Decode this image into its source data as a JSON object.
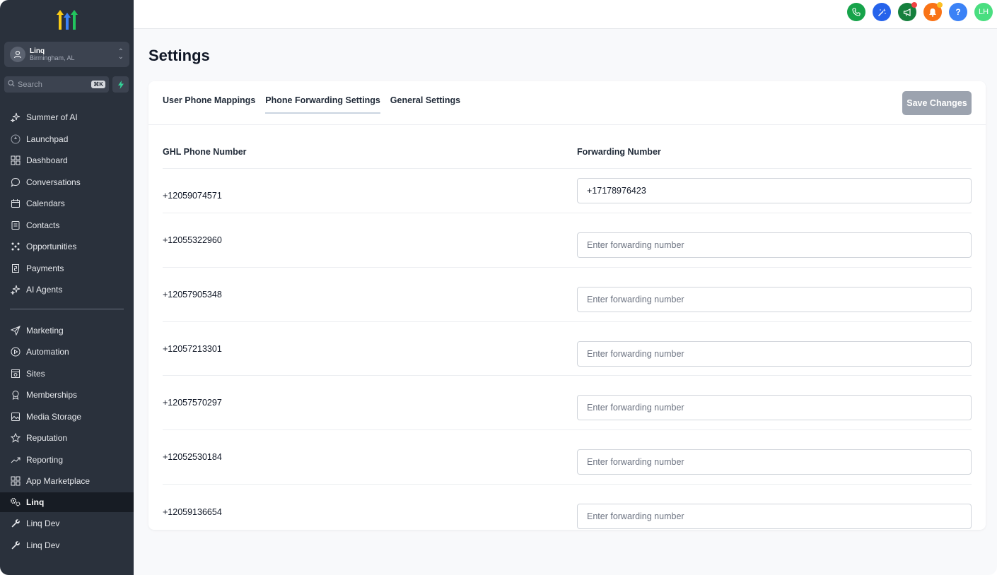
{
  "sidebar": {
    "location": {
      "name": "Linq",
      "city": "Birmingham, AL"
    },
    "search": {
      "placeholder": "Search",
      "shortcut": "⌘K"
    },
    "nav_primary": [
      {
        "label": "Summer of AI",
        "icon": "sparkle-icon"
      },
      {
        "label": "Launchpad",
        "icon": "rocket-icon"
      },
      {
        "label": "Dashboard",
        "icon": "grid-icon"
      },
      {
        "label": "Conversations",
        "icon": "chat-icon"
      },
      {
        "label": "Calendars",
        "icon": "calendar-icon"
      },
      {
        "label": "Contacts",
        "icon": "contacts-icon"
      },
      {
        "label": "Opportunities",
        "icon": "opportunities-icon"
      },
      {
        "label": "Payments",
        "icon": "payments-icon"
      },
      {
        "label": "AI Agents",
        "icon": "sparkle-icon"
      }
    ],
    "nav_secondary": [
      {
        "label": "Marketing",
        "icon": "send-icon"
      },
      {
        "label": "Automation",
        "icon": "automation-icon"
      },
      {
        "label": "Sites",
        "icon": "sites-icon"
      },
      {
        "label": "Memberships",
        "icon": "award-icon"
      },
      {
        "label": "Media Storage",
        "icon": "image-icon"
      },
      {
        "label": "Reputation",
        "icon": "star-icon"
      },
      {
        "label": "Reporting",
        "icon": "trend-icon"
      },
      {
        "label": "App Marketplace",
        "icon": "grid-icon"
      },
      {
        "label": "Linq",
        "icon": "gears-icon",
        "active": true
      },
      {
        "label": "Linq Dev",
        "icon": "wrench-icon"
      },
      {
        "label": "Linq Dev",
        "icon": "wrench-icon"
      }
    ]
  },
  "topbar": {
    "icons": [
      {
        "name": "phone-icon",
        "color": "#16a34a"
      },
      {
        "name": "magic-icon",
        "color": "#2563eb"
      },
      {
        "name": "megaphone-icon",
        "color": "#15803d"
      },
      {
        "name": "bell-icon",
        "color": "#f97316"
      },
      {
        "name": "help-icon",
        "color": "#3b82f6"
      },
      {
        "name": "user-avatar",
        "color": "#4ade80"
      }
    ],
    "avatar_initials": "LH",
    "help_glyph": "?"
  },
  "page": {
    "title": "Settings",
    "tabs": [
      "User Phone Mappings",
      "Phone Forwarding Settings",
      "General Settings"
    ],
    "active_tab": "Phone Forwarding Settings",
    "save_label": "Save Changes",
    "columns": {
      "phone": "GHL Phone Number",
      "forwarding": "Forwarding Number"
    },
    "input_placeholder": "Enter forwarding number",
    "rows": [
      {
        "phone": "+12059074571",
        "forwarding": "+17178976423"
      },
      {
        "phone": "+12055322960",
        "forwarding": ""
      },
      {
        "phone": "+12057905348",
        "forwarding": ""
      },
      {
        "phone": "+12057213301",
        "forwarding": ""
      },
      {
        "phone": "+12057570297",
        "forwarding": ""
      },
      {
        "phone": "+12052530184",
        "forwarding": ""
      },
      {
        "phone": "+12059136654",
        "forwarding": ""
      }
    ]
  },
  "colors": {
    "sidebar_bg": "#2a313c",
    "active_nav_bg": "#171c24",
    "save_button": "#9ca3af",
    "bolt": "#34d399"
  }
}
